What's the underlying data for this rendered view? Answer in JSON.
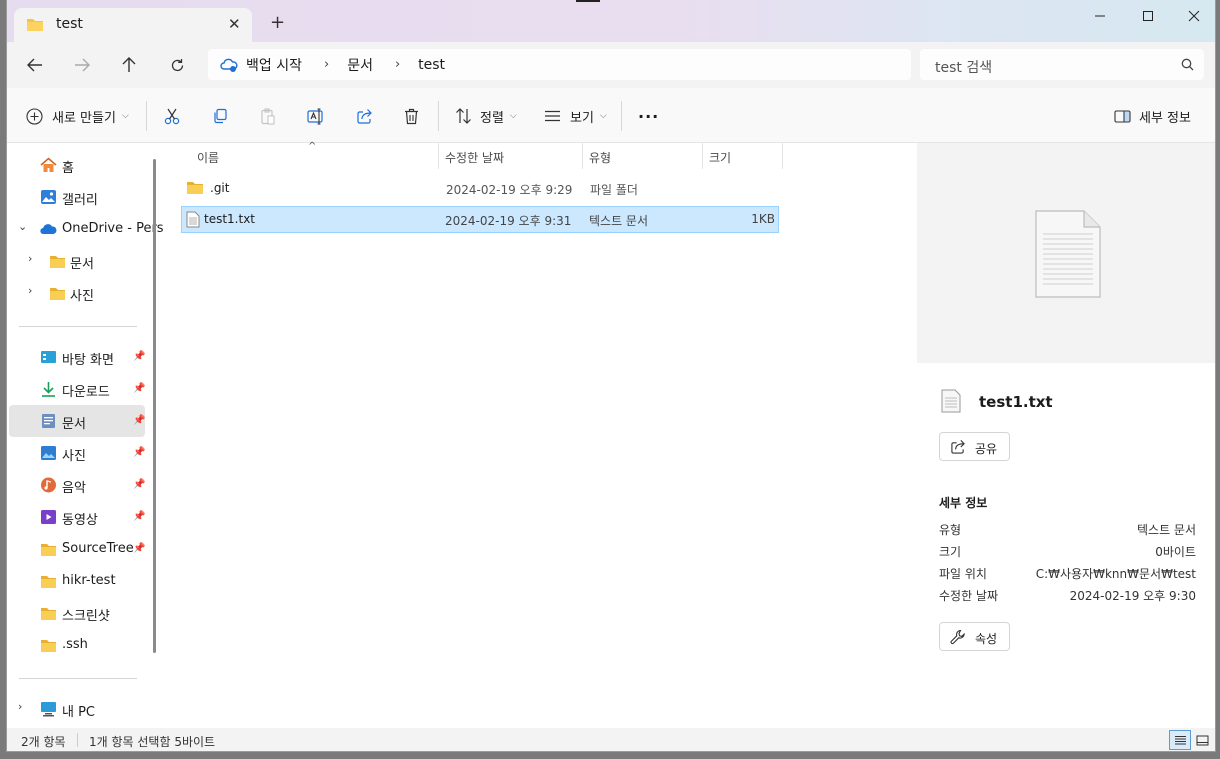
{
  "tab": {
    "title": "test"
  },
  "address": {
    "crumbs": [
      "백업 시작",
      "문서",
      "test"
    ]
  },
  "search": {
    "placeholder": "test 검색"
  },
  "toolbar": {
    "new_label": "새로 만들기",
    "sort_label": "정렬",
    "view_label": "보기",
    "more_label": "···",
    "details_label": "세부 정보"
  },
  "nav": {
    "items": [
      {
        "label": "홈",
        "icon": "home-icon"
      },
      {
        "label": "갤러리",
        "icon": "gallery-icon"
      },
      {
        "label": "OneDrive - Pers",
        "icon": "onedrive-icon"
      },
      {
        "label": "문서",
        "icon": "folder-icon"
      },
      {
        "label": "사진",
        "icon": "folder-icon"
      },
      {
        "label": "바탕 화면",
        "icon": "desktop-icon"
      },
      {
        "label": "다운로드",
        "icon": "download-icon"
      },
      {
        "label": "문서",
        "icon": "documents-icon"
      },
      {
        "label": "사진",
        "icon": "pictures-icon"
      },
      {
        "label": "음악",
        "icon": "music-icon"
      },
      {
        "label": "동영상",
        "icon": "video-icon"
      },
      {
        "label": "SourceTree",
        "icon": "folder-icon"
      },
      {
        "label": "hikr-test",
        "icon": "folder-icon"
      },
      {
        "label": "스크린샷",
        "icon": "folder-icon"
      },
      {
        "label": ".ssh",
        "icon": "folder-icon"
      },
      {
        "label": "내 PC",
        "icon": "pc-icon"
      }
    ]
  },
  "list": {
    "headers": {
      "name": "이름",
      "modified": "수정한 날짜",
      "type": "유형",
      "size": "크기"
    },
    "rows": [
      {
        "name": ".git",
        "modified": "2024-02-19 오후 9:29",
        "type": "파일 폴더",
        "size": ""
      },
      {
        "name": "test1.txt",
        "modified": "2024-02-19 오후 9:31",
        "type": "텍스트 문서",
        "size": "1KB"
      }
    ]
  },
  "details": {
    "filename": "test1.txt",
    "share_label": "공유",
    "section_title": "세부 정보",
    "props": [
      {
        "key": "유형",
        "value": "텍스트 문서"
      },
      {
        "key": "크기",
        "value": "0바이트"
      },
      {
        "key": "파일 위치",
        "value": "C:₩사용자₩knn₩문서₩test"
      },
      {
        "key": "수정한 날짜",
        "value": "2024-02-19 오후 9:30"
      }
    ],
    "properties_label": "속성"
  },
  "status": {
    "count": "2개 항목",
    "selection": "1개 항목 선택함 5바이트"
  },
  "colors": {
    "selection_bg": "#cce8ff",
    "folder_yellow": "#f6c443",
    "accent_blue": "#0078d4"
  }
}
